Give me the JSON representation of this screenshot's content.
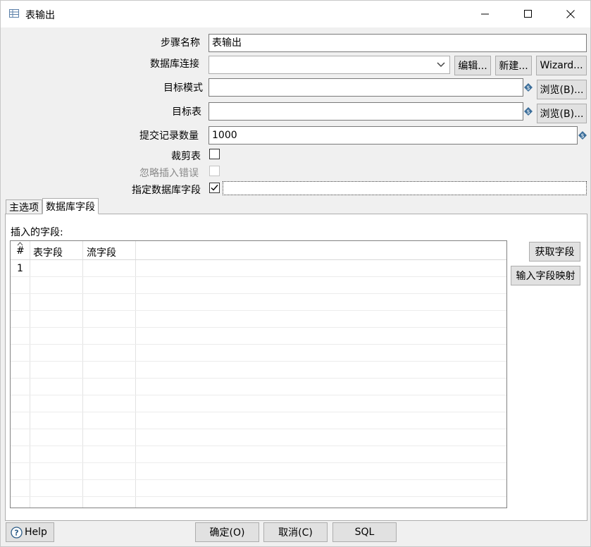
{
  "window": {
    "title": "表输出",
    "controls": [
      "minimize-icon",
      "maximize-icon",
      "close-icon"
    ]
  },
  "form": {
    "step_name_label": "步骤名称",
    "step_name_value": "表输出",
    "connection_label": "数据库连接",
    "connection_value": "",
    "edit_button": "编辑...",
    "new_button": "新建...",
    "wizard_button": "Wizard...",
    "target_schema_label": "目标模式",
    "target_schema_value": "",
    "browse_schema_button": "浏览(B)...",
    "target_table_label": "目标表",
    "target_table_value": "",
    "browse_table_button": "浏览(B)...",
    "commit_size_label": "提交记录数量",
    "commit_size_value": "1000",
    "truncate_label": "裁剪表",
    "truncate_checked": false,
    "ignore_errors_label": "忽略插入错误",
    "ignore_errors_checked": false,
    "specify_fields_label": "指定数据库字段",
    "specify_fields_checked": true
  },
  "tabs": [
    {
      "label": "主选项",
      "active": false
    },
    {
      "label": "数据库字段",
      "active": true
    }
  ],
  "fields_panel": {
    "heading": "插入的字段:",
    "columns": [
      "#",
      "表字段",
      "流字段"
    ],
    "rows": [
      {
        "num": "1",
        "table_field": "",
        "stream_field": ""
      }
    ],
    "get_fields_button": "获取字段",
    "input_mapping_button": "输入字段映射"
  },
  "footer": {
    "help_button": "Help",
    "ok_button": "确定(O)",
    "cancel_button": "取消(C)",
    "sql_button": "SQL"
  },
  "colors": {
    "window_bg": "#f0f0f0",
    "button_bg": "#e1e1e1",
    "variable_icon": "#3c6e9a"
  }
}
